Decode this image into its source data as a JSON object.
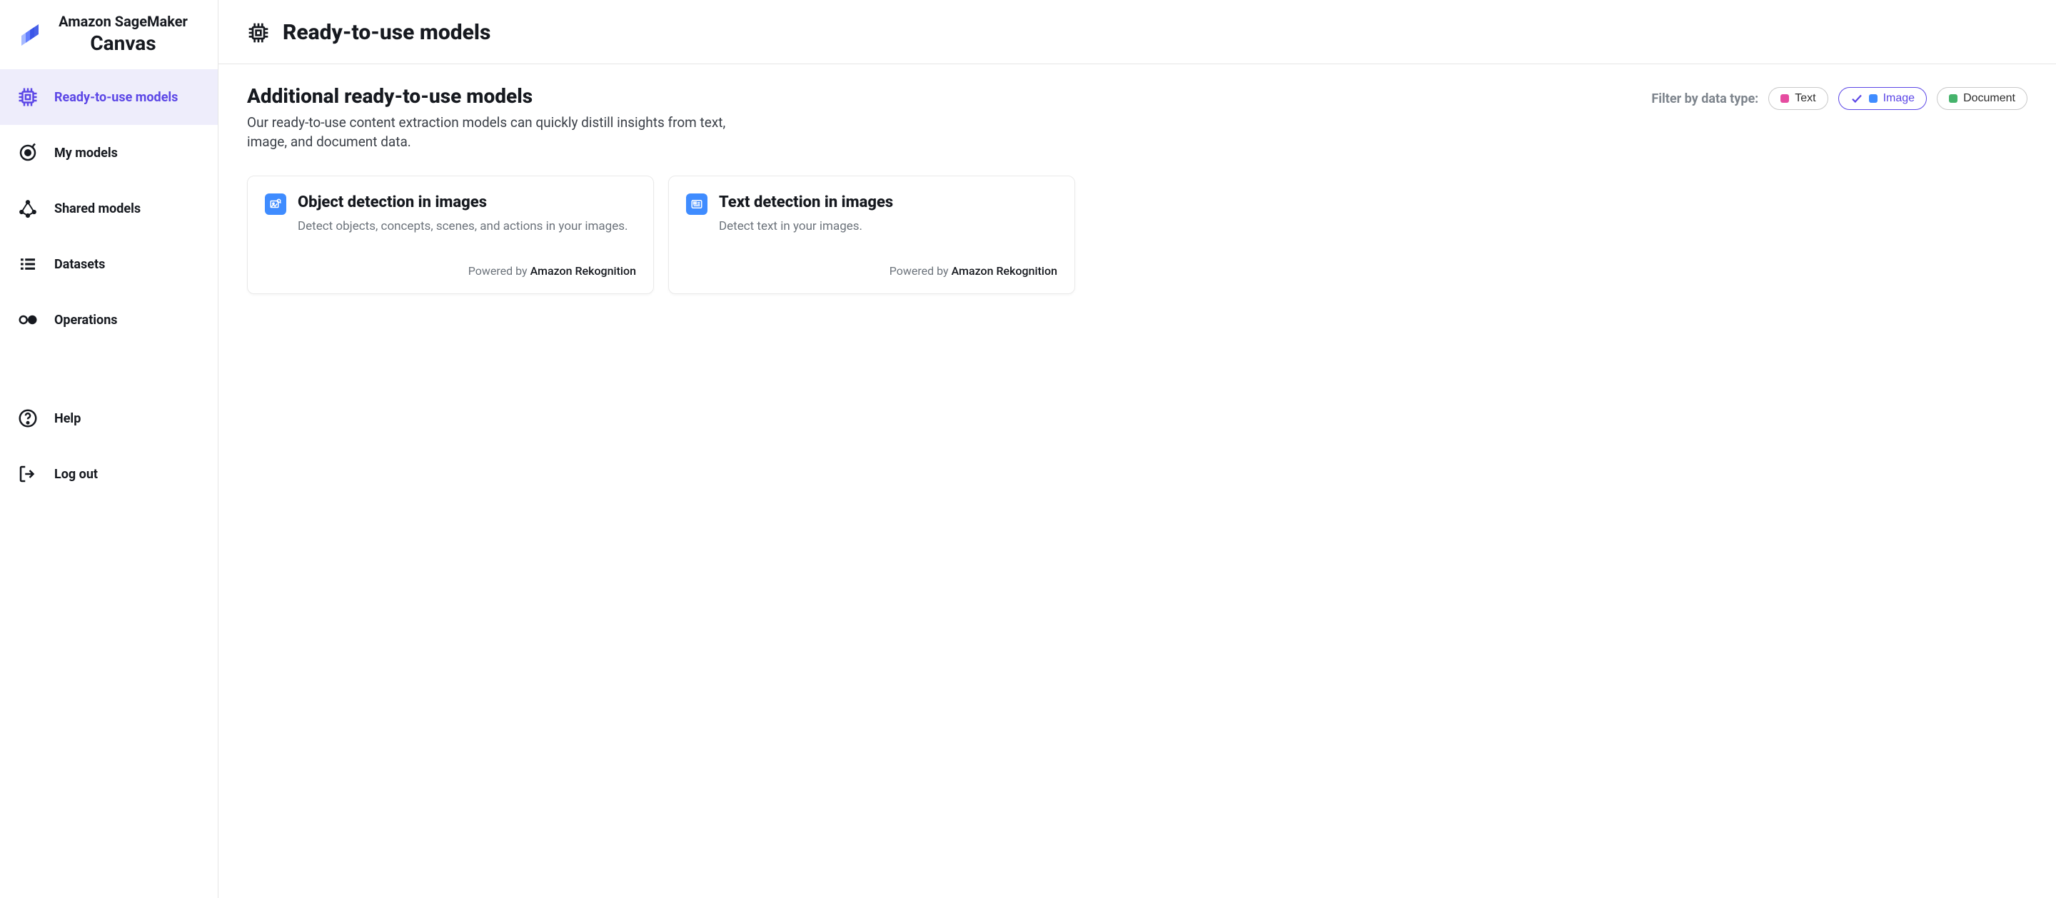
{
  "brand": {
    "line1": "Amazon SageMaker",
    "line2": "Canvas"
  },
  "sidebar": {
    "items": [
      {
        "label": "Ready-to-use models"
      },
      {
        "label": "My models"
      },
      {
        "label": "Shared models"
      },
      {
        "label": "Datasets"
      },
      {
        "label": "Operations"
      },
      {
        "label": "Help"
      },
      {
        "label": "Log out"
      }
    ]
  },
  "page": {
    "title": "Ready-to-use models"
  },
  "section": {
    "title": "Additional ready-to-use models",
    "description": "Our ready-to-use content extraction models can quickly distill insights from text, image, and document data."
  },
  "filters": {
    "label": "Filter by data type:",
    "chips": [
      {
        "label": "Text",
        "color": "#e54ca0"
      },
      {
        "label": "Image",
        "color": "#3f8cff"
      },
      {
        "label": "Document",
        "color": "#45b36b"
      }
    ]
  },
  "cards": [
    {
      "title": "Object detection in images",
      "description": "Detect objects, concepts, scenes, and actions in your images.",
      "powered_prefix": "Powered by ",
      "provider": "Amazon Rekognition"
    },
    {
      "title": "Text detection in images",
      "description": "Detect text in your images.",
      "powered_prefix": "Powered by ",
      "provider": "Amazon Rekognition"
    }
  ]
}
